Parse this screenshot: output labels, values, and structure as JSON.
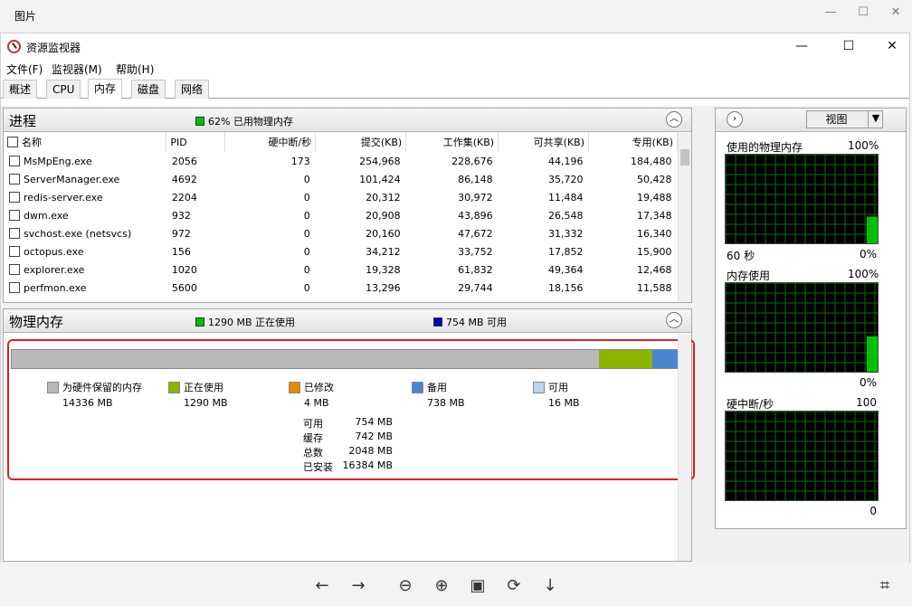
{
  "photos": {
    "title": "图片"
  },
  "app": {
    "title": "资源监视器"
  },
  "menu": [
    "文件(F)",
    "监视器(M)",
    "帮助(H)"
  ],
  "tabs": [
    "概述",
    "CPU",
    "内存",
    "磁盘",
    "网络"
  ],
  "process": {
    "title": "进程",
    "usage_text": "62% 已用物理内存",
    "usage_color": "#00c000",
    "columns": [
      "名称",
      "PID",
      "硬中断/秒",
      "提交(KB)",
      "工作集(KB)",
      "可共享(KB)",
      "专用(KB)"
    ],
    "rows": [
      [
        "MsMpEng.exe",
        "2056",
        "173",
        "254,968",
        "228,676",
        "44,196",
        "184,480"
      ],
      [
        "ServerManager.exe",
        "4692",
        "0",
        "101,424",
        "86,148",
        "35,720",
        "50,428"
      ],
      [
        "redis-server.exe",
        "2204",
        "0",
        "20,312",
        "30,972",
        "11,484",
        "19,488"
      ],
      [
        "dwm.exe",
        "932",
        "0",
        "20,908",
        "43,896",
        "26,548",
        "17,348"
      ],
      [
        "svchost.exe (netsvcs)",
        "972",
        "0",
        "20,160",
        "47,672",
        "31,332",
        "16,340"
      ],
      [
        "octopus.exe",
        "156",
        "0",
        "34,212",
        "33,752",
        "17,852",
        "15,900"
      ],
      [
        "explorer.exe",
        "1020",
        "0",
        "19,328",
        "61,832",
        "49,364",
        "12,468"
      ],
      [
        "perfmon.exe",
        "5600",
        "0",
        "13,296",
        "29,744",
        "18,156",
        "11,588"
      ]
    ]
  },
  "physical": {
    "title": "物理内存",
    "in_use_text": "1290 MB 正在使用",
    "available_text": "754 MB 可用",
    "bar": {
      "reserved": 14336,
      "in_use": 1290,
      "modified": 4,
      "standby": 738,
      "free": 16
    },
    "legend": [
      {
        "label": "为硬件保留的内存",
        "value": "14336 MB",
        "color": "#b8b8b8"
      },
      {
        "label": "正在使用",
        "value": "1290 MB",
        "color": "#8db500"
      },
      {
        "label": "已修改",
        "value": "4 MB",
        "color": "#e88a00"
      },
      {
        "label": "备用",
        "value": "738 MB",
        "color": "#4a86d0"
      },
      {
        "label": "可用",
        "value": "16 MB",
        "color": "#b8d4f0"
      }
    ],
    "stats": [
      {
        "label": "可用",
        "value": "754 MB"
      },
      {
        "label": "缓存",
        "value": "742 MB"
      },
      {
        "label": "总数",
        "value": "2048 MB"
      },
      {
        "label": "已安装",
        "value": "16384 MB"
      }
    ]
  },
  "side": {
    "view_label": "视图",
    "graphs": [
      {
        "title": "使用的物理内存",
        "top": "100%",
        "bottom_left": "60 秒",
        "bottom_right": "0%",
        "level": 0.3
      },
      {
        "title": "内存使用",
        "top": "100%",
        "bottom_left": "",
        "bottom_right": "0%",
        "level": 0.4
      },
      {
        "title": "硬中断/秒",
        "top": "100",
        "bottom_left": "",
        "bottom_right": "0",
        "level": 0
      }
    ]
  },
  "highlight_color": "#e02020"
}
